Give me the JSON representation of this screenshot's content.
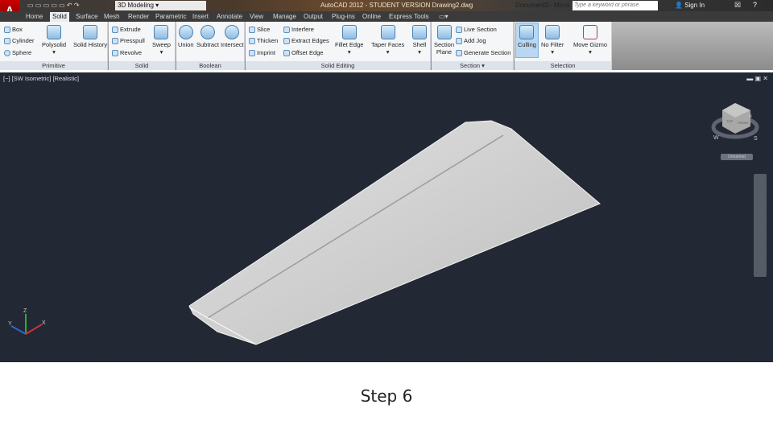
{
  "title_bar": {
    "app_title": "AutoCAD 2012 - STUDENT VERSION   Drawing2.dwg",
    "workspace": "3D Modeling",
    "other_window": "Document3 - Micro",
    "search_placeholder": "Type a keyword or phrase",
    "sign_in": "Sign In",
    "app_button": "A"
  },
  "tabs": [
    "Home",
    "Solid",
    "Surface",
    "Mesh",
    "Render",
    "Parametric",
    "Insert",
    "Annotate",
    "View",
    "Manage",
    "Output",
    "Plug-ins",
    "Online",
    "Express Tools"
  ],
  "active_tab": "Solid",
  "ribbon": {
    "primitive": {
      "title": "Primitive",
      "items": [
        "Box",
        "Cylinder",
        "Sphere"
      ],
      "big": [
        "Polysolid",
        "Solid History"
      ]
    },
    "solid": {
      "title": "Solid",
      "items": [
        "Extrude",
        "Presspull",
        "Revolve"
      ],
      "big": [
        "Sweep"
      ]
    },
    "boolean": {
      "title": "Boolean",
      "big": [
        "Union",
        "Subtract",
        "Intersect"
      ]
    },
    "solid_editing": {
      "title": "Solid Editing",
      "items": [
        "Slice",
        "Thicken",
        "Imprint",
        "Interfere",
        "Extract Edges",
        "Offset Edge"
      ],
      "big": [
        "Fillet Edge",
        "Taper Faces",
        "Shell"
      ]
    },
    "section": {
      "title": "Section",
      "big": [
        "Section",
        "Plane"
      ],
      "items": [
        "Live Section",
        "Add Jog",
        "Generate Section"
      ]
    },
    "selection": {
      "title": "Selection",
      "big": [
        "Culling",
        "No Filter",
        "Move Gizmo"
      ]
    }
  },
  "viewport": {
    "label": "[−] [SW Isometric] [Realistic]",
    "view_name": "Unnamed",
    "cube_face": "TOP",
    "cube_side": "FRONT",
    "compass": [
      "W",
      "S",
      "N"
    ],
    "axes": [
      "X",
      "Y",
      "Z"
    ]
  },
  "caption": "Step 6",
  "colors": {
    "viewport_bg": "#222834",
    "accent": "#5a8fc0"
  }
}
